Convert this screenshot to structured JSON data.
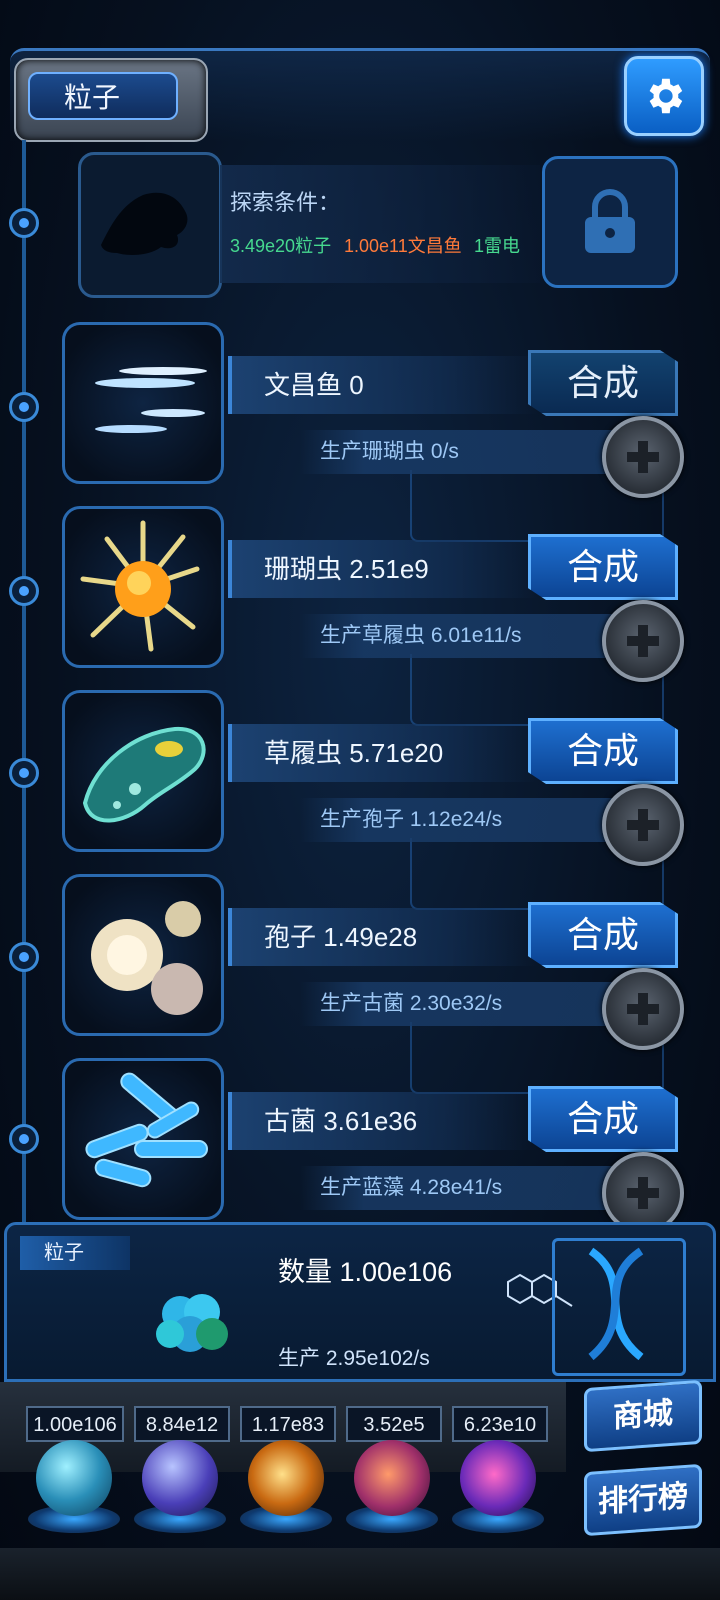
{
  "header": {
    "title": "粒子"
  },
  "locked": {
    "title": "探索条件：",
    "conditions": [
      {
        "text": "3.49e20粒子",
        "color": "#46d98f"
      },
      {
        "text": "1.00e11文昌鱼",
        "color": "#ff7a3a"
      },
      {
        "text": "1雷电",
        "color": "#46d98f"
      }
    ]
  },
  "creatures": [
    {
      "name": "文昌鱼 0",
      "produce": "生产珊瑚虫 0/s",
      "button": "合成",
      "icon": "lancelet-icon"
    },
    {
      "name": "珊瑚虫 2.51e9",
      "produce": "生产草履虫 6.01e11/s",
      "button": "合成",
      "icon": "coral-polyp-icon"
    },
    {
      "name": "草履虫 5.71e20",
      "produce": "生产孢子 1.12e24/s",
      "button": "合成",
      "icon": "paramecium-icon"
    },
    {
      "name": "孢子 1.49e28",
      "produce": "生产古菌 2.30e32/s",
      "button": "合成",
      "icon": "spore-icon"
    },
    {
      "name": "古菌 3.61e36",
      "produce": "生产蓝藻 4.28e41/s",
      "button": "合成",
      "icon": "archaea-icon"
    }
  ],
  "particle": {
    "label": "粒子",
    "quantity": "数量 1.00e106",
    "production": "生产 2.95e102/s"
  },
  "resources": [
    "1.00e106",
    "8.84e12",
    "1.17e83",
    "3.52e5",
    "6.23e10"
  ],
  "side_buttons": {
    "shop": "商城",
    "rank": "排行榜"
  }
}
